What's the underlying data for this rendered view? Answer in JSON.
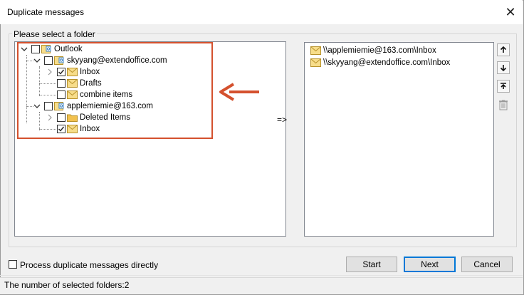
{
  "window": {
    "title": "Duplicate messages"
  },
  "group": {
    "label": "Please select a folder"
  },
  "tree": {
    "items": [
      {
        "label": "Outlook",
        "checked": false,
        "icon": "account-folder-icon"
      },
      {
        "label": "skyyang@extendoffice.com",
        "checked": false,
        "icon": "account-folder-icon"
      },
      {
        "label": "Inbox",
        "checked": true,
        "icon": "mail-folder-icon"
      },
      {
        "label": "Drafts",
        "checked": false,
        "icon": "mail-folder-icon"
      },
      {
        "label": "combine items",
        "checked": false,
        "icon": "mail-folder-icon"
      },
      {
        "label": "applemiemie@163.com",
        "checked": false,
        "icon": "account-folder-icon"
      },
      {
        "label": "Deleted Items",
        "checked": false,
        "icon": "folder-icon"
      },
      {
        "label": "Inbox",
        "checked": true,
        "icon": "mail-folder-icon"
      }
    ]
  },
  "transfer": {
    "arrow_label": "=>"
  },
  "selected": {
    "items": [
      {
        "label": "\\\\applemiemie@163.com\\Inbox"
      },
      {
        "label": "\\\\skyyang@extendoffice.com\\Inbox"
      }
    ]
  },
  "options": {
    "process_directly_label": "Process duplicate messages directly",
    "process_directly_checked": false
  },
  "buttons": {
    "start": "Start",
    "next": "Next",
    "cancel": "Cancel"
  },
  "status": {
    "text": "The number of selected folders:2"
  },
  "colors": {
    "annotation": "#d4512e",
    "focus_border": "#0078d7",
    "folder": "#f2c14e"
  }
}
